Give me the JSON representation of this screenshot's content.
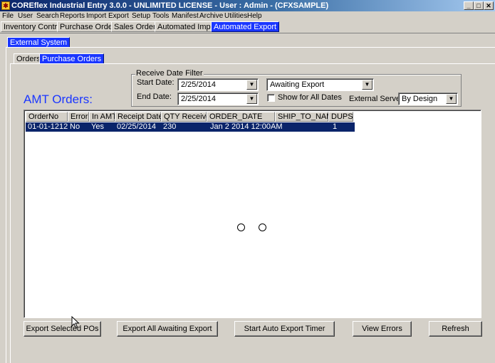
{
  "window": {
    "title": "COREflex Industrial Entry 3.0.0 - UNLIMITED LICENSE - User : Admin - (CFXSAMPLE)",
    "controls": [
      "_",
      "□",
      "✕"
    ]
  },
  "menu": [
    "File",
    "User",
    "Search",
    "Reports",
    "Import",
    "Export",
    "Setup",
    "Tools",
    "Manifest",
    "Archive",
    "Utilities",
    "Help"
  ],
  "main_tabs": [
    "Inventory Control",
    "Purchase Orders",
    "Sales Orders",
    "Automated Import",
    "Automated Export"
  ],
  "sub_tabs": [
    "External System"
  ],
  "sub_sub_tabs": [
    "Orders",
    "Purchase Orders"
  ],
  "filter": {
    "legend": "Receive Date Filter",
    "start_label": "Start Date:",
    "start_value": "2/25/2014",
    "end_label": "End Date:",
    "end_value": "2/25/2014",
    "status_value": "Awaiting Export",
    "show_all_label": "Show for All Dates",
    "server_label": "External Server:",
    "server_value": "By Design"
  },
  "section_title": "AMT Orders:",
  "grid": {
    "columns": [
      "OrderNo",
      "Error",
      "In AMT",
      "Receipt Date",
      "QTY Received",
      "ORDER_DATE",
      "SHIP_TO_NAME",
      "DUPS"
    ],
    "rows": [
      [
        "01-01-1212",
        "No",
        "Yes",
        "02/25/2014",
        "230",
        "Jan  2 2014 12:00AM",
        "",
        "1"
      ]
    ]
  },
  "buttons": {
    "export_selected": "Export Selected POs",
    "export_all": "Export All Awaiting Export",
    "start_timer": "Start Auto Export Timer",
    "view_errors": "View Errors",
    "refresh": "Refresh"
  },
  "colors": {
    "accent": "#1a36ff",
    "selection": "#0a246a",
    "face": "#d4d0c8"
  }
}
